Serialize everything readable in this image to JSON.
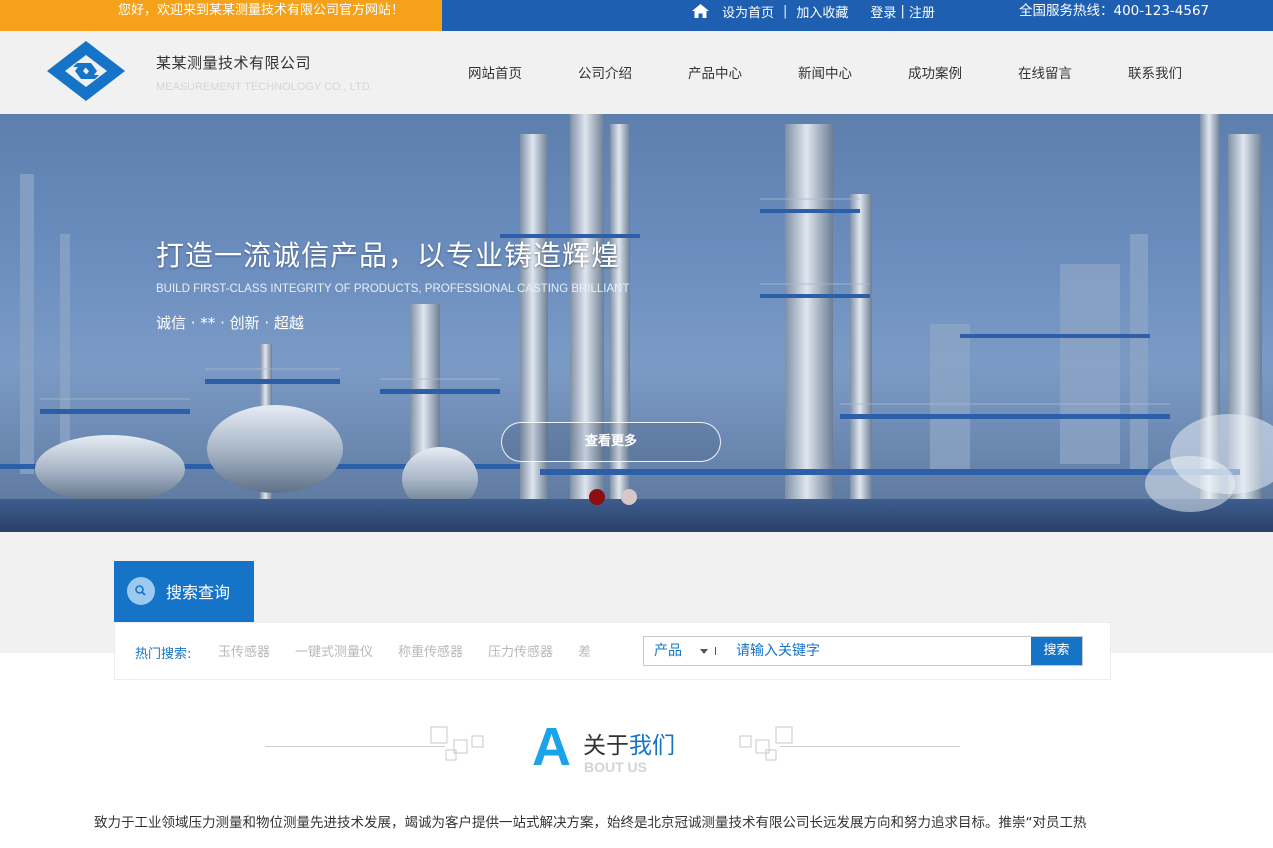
{
  "topbar": {
    "welcome": "您好，欢迎来到某某测量技术有限公司官方网站！",
    "set_home": "设为首页",
    "sep1": "|",
    "favorite": "加入收藏",
    "login": "登录",
    "sep2": "|",
    "register": "注册",
    "hotline": "全国服务热线：400-123-4567"
  },
  "header": {
    "company_cn": "某某测量技术有限公司",
    "company_en": "MEASUREMENT TECHNOLOGY CO., LTD.",
    "nav": [
      {
        "label": "网站首页"
      },
      {
        "label": "公司介绍"
      },
      {
        "label": "产品中心"
      },
      {
        "label": "新闻中心"
      },
      {
        "label": "成功案例"
      },
      {
        "label": "在线留言"
      },
      {
        "label": "联系我们"
      }
    ]
  },
  "banner": {
    "title": "打造一流诚信产品，以专业铸造辉煌",
    "subtitle": "BUILD FIRST-CLASS INTEGRITY OF PRODUCTS, PROFESSIONAL CASTING BRILLIANT",
    "slogan": "诚信 · ** · 创新 · 超越",
    "more_button": "查看更多",
    "slides": 2,
    "active_slide": 1
  },
  "search": {
    "tab_label": "搜索查询",
    "hot_label": "热门搜索:",
    "hot_tags": [
      "玉传感器",
      "一键式测量仪",
      "称重传感器",
      "压力传感器",
      "差"
    ],
    "select_value": "产品",
    "input_placeholder": "请输入关键字",
    "button_label": "搜索"
  },
  "about": {
    "letter": "A",
    "title_plain": "关于",
    "title_highlight": "我们",
    "title_en": "BOUT US",
    "text": "致力于工业领域压力测量和物位测量先进技术发展，竭诚为客户提供一站式解决方案，始终是北京冠诚测量技术有限公司长远发展方向和努力追求目标。推崇“对员工热"
  },
  "colors": {
    "topbar_blue": "#1e5fb2",
    "welcome_orange": "#f5a21a",
    "brand_blue": "#1574c8",
    "accent_cyan": "#1aa3e8",
    "dot_active": "#8d0e0e"
  },
  "icons": {
    "home": "home-icon",
    "logo": "logo-icon",
    "search": "search-icon"
  }
}
